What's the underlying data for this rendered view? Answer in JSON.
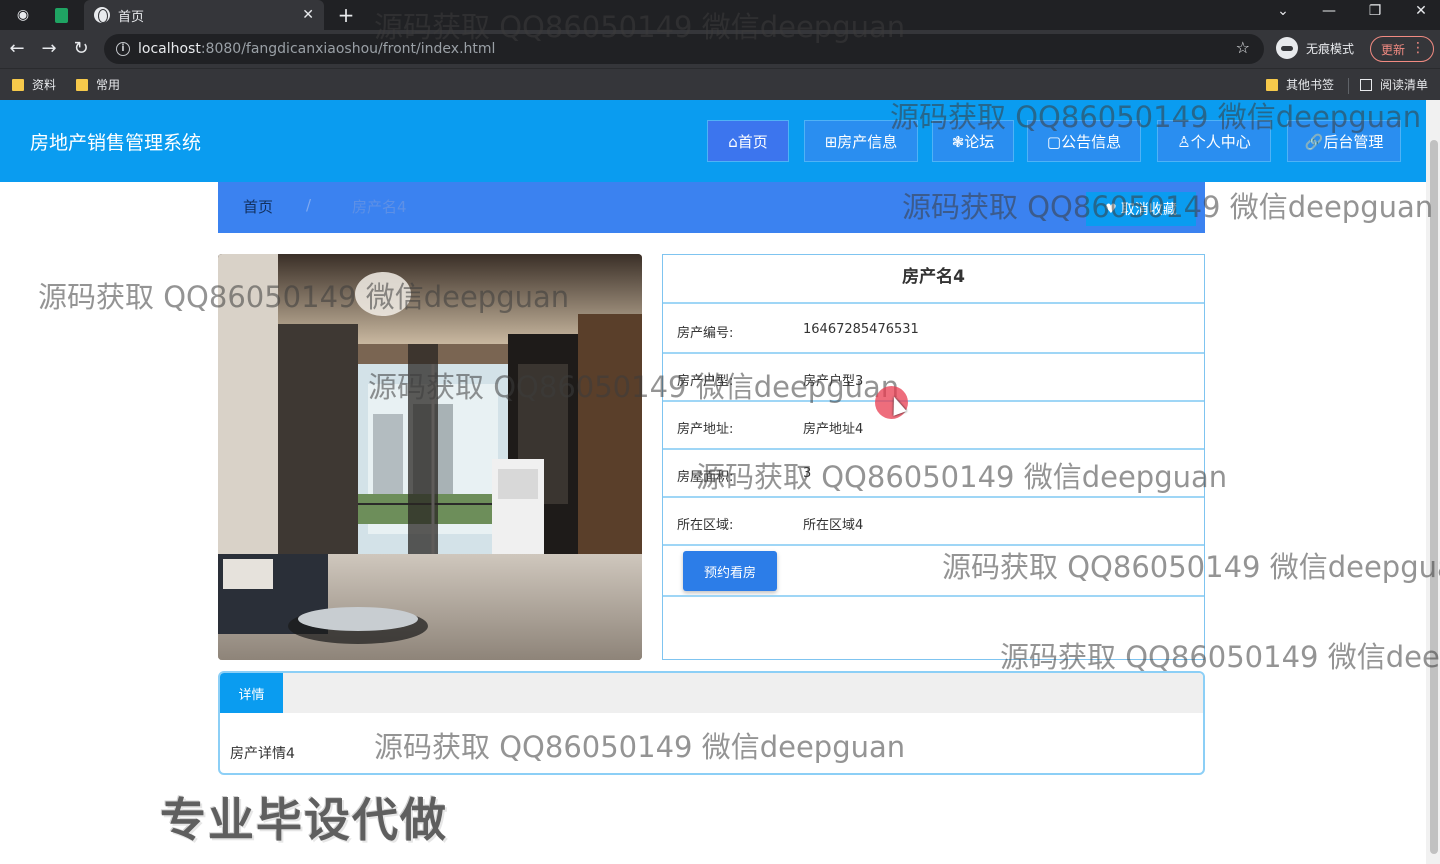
{
  "browser": {
    "tab_title": "首页",
    "url_host": "localhost",
    "url_rest": ":8080/fangdicanxiaoshou/front/index.html",
    "incognito_label": "无痕模式",
    "update_label": "更新",
    "bookmarks": [
      "资料",
      "常用"
    ],
    "other_bookmarks": "其他书签",
    "reading_list": "阅读清单"
  },
  "app": {
    "title": "房地产销售管理系统",
    "nav": [
      {
        "label": "⌂首页"
      },
      {
        "label": "⊞房产信息"
      },
      {
        "label": "❃论坛"
      },
      {
        "label": "▢公告信息"
      },
      {
        "label": "♙个人中心"
      },
      {
        "label": "🔗后台管理"
      }
    ]
  },
  "breadcrumb": {
    "home": "首页",
    "separator": "/",
    "current": "房产名4"
  },
  "favorite_button": "取消收藏",
  "house": {
    "name": "房产名4",
    "rows": [
      {
        "label": "房产编号:",
        "value": "16467285476531"
      },
      {
        "label": "房产户型:",
        "value": "房产户型3"
      },
      {
        "label": "房产地址:",
        "value": "房产地址4"
      },
      {
        "label": "房屋面积:",
        "value": "3"
      },
      {
        "label": "所在区域:",
        "value": "所在区域4"
      }
    ],
    "book_button": "预约看房"
  },
  "details": {
    "tab": "详情",
    "text": "房产详情4"
  },
  "promo": "专业毕设代做",
  "watermark": "源码获取 QQ86050149 微信deepguan",
  "colors": {
    "header": "#0a9cf0",
    "breadcrumb": "#3b82f0",
    "button": "#2c7de8"
  }
}
